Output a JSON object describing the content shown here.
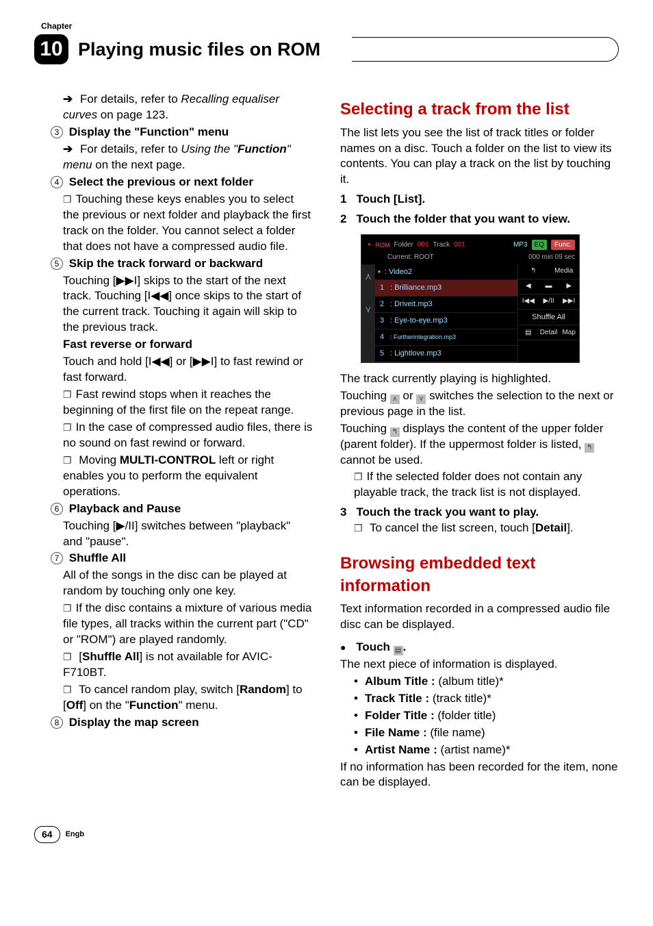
{
  "header": {
    "chapter_label": "Chapter",
    "chapter_num": "10",
    "chapter_title": "Playing music files on ROM"
  },
  "left": {
    "ref1_a": "For details, refer to ",
    "ref1_b": "Recalling equaliser curves",
    "ref1_c": " on page 123.",
    "i3": "Display the \"Function\" menu",
    "ref2_a": "For details, refer to ",
    "ref2_b": "Using the ",
    "ref2_c": "\"",
    "ref2_d": "Function",
    "ref2_e": "\" menu",
    "ref2_f": " on the next page.",
    "i4": "Select the previous or next folder",
    "p4a": "Touching these keys enables you to select the previous or next folder and playback the first track on the folder. You cannot select a folder that does not have a compressed audio file.",
    "i5": "Skip the track forward or backward",
    "p5a_a": "Touching [",
    "p5a_b": "] skips to the start of the next track. Touching [",
    "p5a_c": "] once skips to the start of the current track. Touching it again will skip to the previous track.",
    "p5b": "Fast reverse or forward",
    "p5c_a": "Touch and hold [",
    "p5c_b": "] or [",
    "p5c_c": "] to fast rewind or fast forward.",
    "p5d": "Fast rewind stops when it reaches the beginning of the first file on the repeat range.",
    "p5e": "In the case of compressed audio files, there is no sound on fast rewind or forward.",
    "p5f_a": "Moving ",
    "p5f_b": "MULTI-CONTROL",
    "p5f_c": " left or right enables you to perform the equivalent operations.",
    "i6": "Playback and Pause",
    "p6_a": "Touching [",
    "p6_b": "] switches between \"playback\" and \"pause\".",
    "i7": "Shuffle All",
    "p7a": "All of the songs in the disc can be played at random by touching only one key.",
    "p7b": "If the disc contains a mixture of various media file types, all tracks within the current part (\"CD\" or \"ROM\") are played randomly.",
    "p7c_a": "[",
    "p7c_b": "Shuffle All",
    "p7c_c": "] is not available for AVIC-F710BT.",
    "p7d_a": "To cancel random play, switch [",
    "p7d_b": "Random",
    "p7d_c": "] to [",
    "p7d_d": "Off",
    "p7d_e": "] on the \"",
    "p7d_f": "Function",
    "p7d_g": "\" menu.",
    "i8": "Display the map screen"
  },
  "right": {
    "h1": "Selecting a track from the list",
    "h1p": "The list lets you see the list of track titles or folder names on a disc. Touch a folder on the list to view its contents. You can play a track on the list by touching it.",
    "s1": "Touch [List].",
    "s2": "Touch the folder that you want to view.",
    "after_shot_1": "The track currently playing is highlighted.",
    "after_shot_2a": "Touching ",
    "after_shot_2b": " or ",
    "after_shot_2c": " switches the selection to the next or previous page in the list.",
    "after_shot_3a": "Touching ",
    "after_shot_3b": " displays the content of the upper folder (parent folder). If the uppermost folder is listed, ",
    "after_shot_3c": " cannot be used.",
    "after_shot_4": "If the selected folder does not contain any playable track, the track list is not displayed.",
    "s3": "Touch the track you want to play.",
    "s3a_a": "To cancel the list screen, touch [",
    "s3a_b": "Detail",
    "s3a_c": "].",
    "h2": "Browsing embedded text information",
    "h2p": "Text information recorded in a compressed audio file disc can be displayed.",
    "touch_a": "Touch ",
    "touch_b": ".",
    "touch_next": "The next piece of information is displayed.",
    "li1_a": "Album Title :",
    "li1_b": " (album title)*",
    "li2_a": "Track Title :",
    "li2_b": " (track title)*",
    "li3_a": "Folder Title :",
    "li3_b": " (folder title)",
    "li4_a": "File Name :",
    "li4_b": " (file name)",
    "li5_a": "Artist Name :",
    "li5_b": " (artist name)*",
    "tail": "If no information has been recorded for the item, none can be displayed."
  },
  "shot": {
    "rom": "ROM",
    "folder": "Folder",
    "fnum": "001",
    "track": "Track",
    "tnum": "001",
    "fmt": "MP3",
    "eq": "EQ",
    "func": "Func.",
    "current": "Current: ROOT",
    "time": "000 min 09 sec",
    "media": "Media",
    "rows": [
      {
        "idx": "",
        "name": ": Video2",
        "icon": "folder"
      },
      {
        "idx": "1",
        "name": ": Brilliance.mp3",
        "hl": true
      },
      {
        "idx": "2",
        "name": ": Driveit.mp3"
      },
      {
        "idx": "3",
        "name": ": Eye-to-eye.mp3"
      },
      {
        "idx": "4",
        "name": ": Furtherintegration.mp3"
      },
      {
        "idx": "5",
        "name": ": Lightlove.mp3"
      }
    ],
    "shuffle": "Shuffle All",
    "detail": "Detail",
    "map": "Map"
  },
  "footer": {
    "page": "64",
    "engb": "Engb"
  }
}
